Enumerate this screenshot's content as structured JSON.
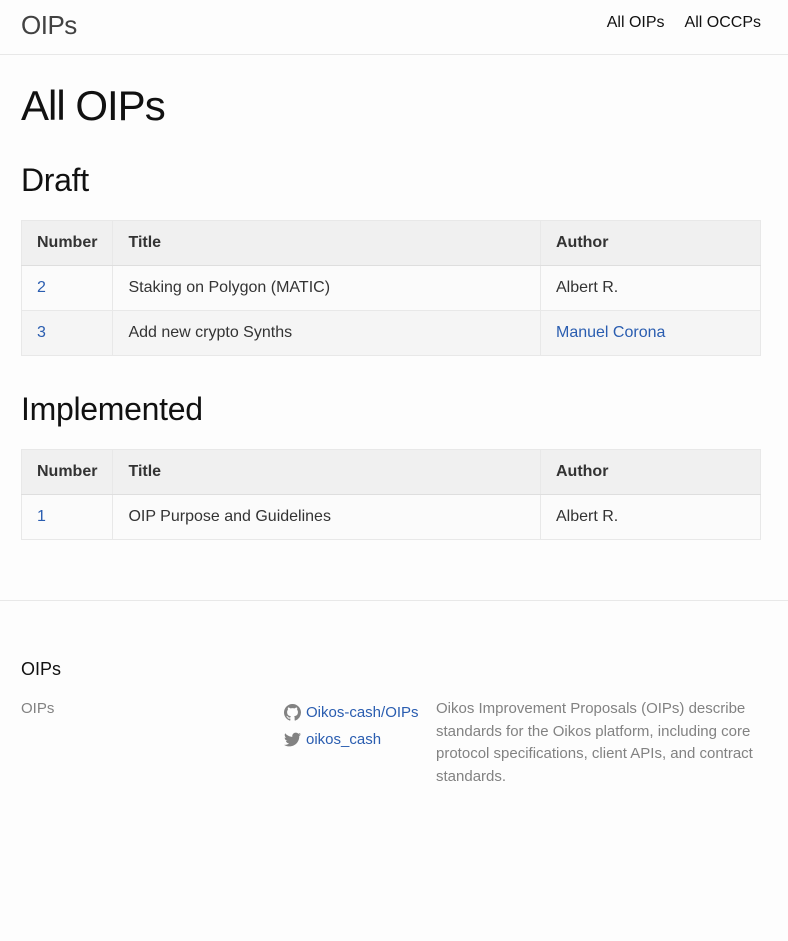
{
  "header": {
    "site_title": "OIPs",
    "nav": [
      {
        "label": "All OIPs"
      },
      {
        "label": "All OCCPs"
      }
    ]
  },
  "main": {
    "page_title": "All OIPs",
    "columns": {
      "number": "Number",
      "title": "Title",
      "author": "Author"
    },
    "sections": [
      {
        "heading": "Draft",
        "rows": [
          {
            "number": "2",
            "title": "Staking on Polygon (MATIC)",
            "author": "Albert R.",
            "author_is_link": false
          },
          {
            "number": "3",
            "title": "Add new crypto Synths",
            "author": "Manuel Corona",
            "author_is_link": true
          }
        ]
      },
      {
        "heading": "Implemented",
        "rows": [
          {
            "number": "1",
            "title": "OIP Purpose and Guidelines",
            "author": "Albert R.",
            "author_is_link": false
          }
        ]
      }
    ]
  },
  "footer": {
    "heading": "OIPs",
    "name": "OIPs",
    "social": [
      {
        "icon": "github-icon",
        "label": "Oikos-cash/OIPs"
      },
      {
        "icon": "twitter-icon",
        "label": "oikos_cash"
      }
    ],
    "description": "Oikos Improvement Proposals (OIPs) describe standards for the Oikos platform, including core protocol specifications, client APIs, and contract standards."
  },
  "colors": {
    "link": "#2a5db0",
    "muted_text": "#828282",
    "table_header_bg": "#f0f0f0",
    "border": "#e8e8e8"
  }
}
